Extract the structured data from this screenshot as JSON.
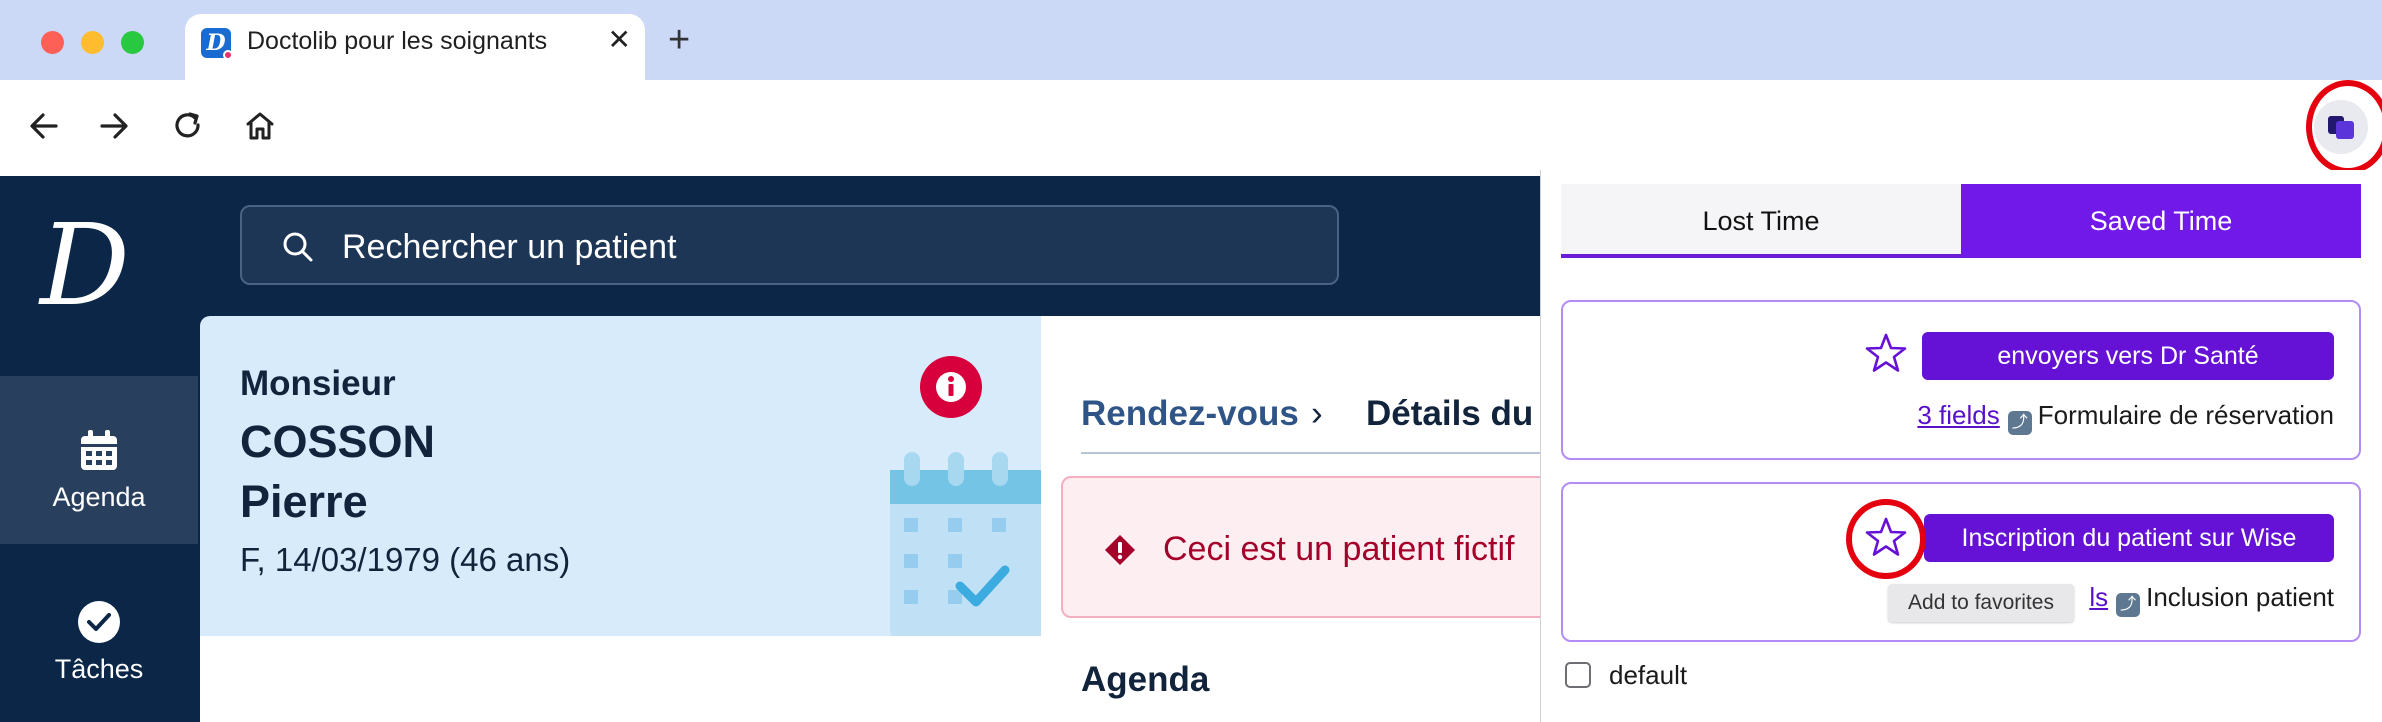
{
  "browser": {
    "tab_title": "Doctolib pour les soignants",
    "tab_close": "✕",
    "new_tab": "+",
    "favicon_letter": "D"
  },
  "app": {
    "logo": "D",
    "search_placeholder": "Rechercher un patient",
    "sidebar": {
      "items": [
        {
          "label": "Agenda",
          "icon": "calendar-icon",
          "active": true
        },
        {
          "label": "Tâches",
          "icon": "check-circle-icon",
          "active": false
        }
      ]
    },
    "patient": {
      "civility": "Monsieur",
      "last_name": "COSSON",
      "first_name": "Pierre",
      "details": "F, 14/03/1979 (46 ans)"
    },
    "breadcrumb": {
      "link": "Rendez-vous",
      "separator": "›",
      "current": "Détails du r"
    },
    "alert": {
      "text": "Ceci est un patient fictif"
    },
    "agenda_heading": "Agenda"
  },
  "extension": {
    "tabs": [
      {
        "label": "Lost Time",
        "selected": false
      },
      {
        "label": "Saved Time",
        "selected": true
      }
    ],
    "cards": [
      {
        "button": "envoyers vers Dr Santé",
        "fields_link": "3 fields",
        "target": "Formulaire de réservation"
      },
      {
        "button": "Inscription du patient sur Wise",
        "fields_link": "ls",
        "target": "Inclusion patient"
      }
    ],
    "tooltip": "Add to favorites",
    "default_label": "default",
    "default_checked": false,
    "accent_color": "#7119e8"
  }
}
